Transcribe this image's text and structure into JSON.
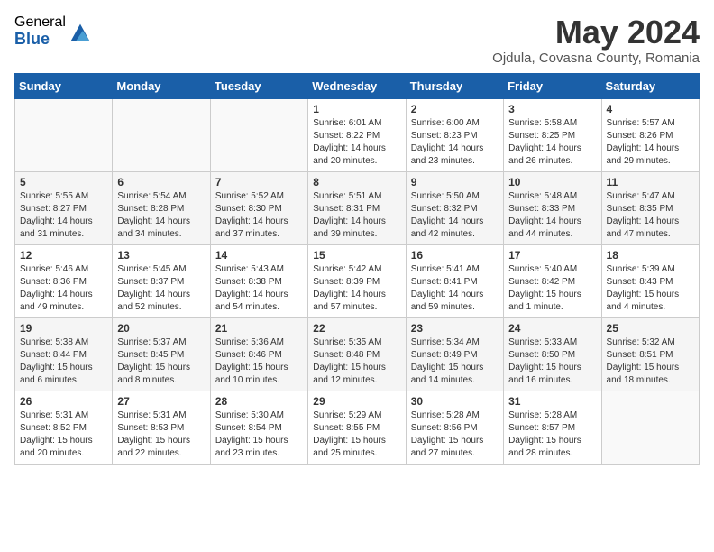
{
  "header": {
    "logo_general": "General",
    "logo_blue": "Blue",
    "month_title": "May 2024",
    "location": "Ojdula, Covasna County, Romania"
  },
  "days_of_week": [
    "Sunday",
    "Monday",
    "Tuesday",
    "Wednesday",
    "Thursday",
    "Friday",
    "Saturday"
  ],
  "weeks": [
    [
      {
        "day": "",
        "content": ""
      },
      {
        "day": "",
        "content": ""
      },
      {
        "day": "",
        "content": ""
      },
      {
        "day": "1",
        "content": "Sunrise: 6:01 AM\nSunset: 8:22 PM\nDaylight: 14 hours\nand 20 minutes."
      },
      {
        "day": "2",
        "content": "Sunrise: 6:00 AM\nSunset: 8:23 PM\nDaylight: 14 hours\nand 23 minutes."
      },
      {
        "day": "3",
        "content": "Sunrise: 5:58 AM\nSunset: 8:25 PM\nDaylight: 14 hours\nand 26 minutes."
      },
      {
        "day": "4",
        "content": "Sunrise: 5:57 AM\nSunset: 8:26 PM\nDaylight: 14 hours\nand 29 minutes."
      }
    ],
    [
      {
        "day": "5",
        "content": "Sunrise: 5:55 AM\nSunset: 8:27 PM\nDaylight: 14 hours\nand 31 minutes."
      },
      {
        "day": "6",
        "content": "Sunrise: 5:54 AM\nSunset: 8:28 PM\nDaylight: 14 hours\nand 34 minutes."
      },
      {
        "day": "7",
        "content": "Sunrise: 5:52 AM\nSunset: 8:30 PM\nDaylight: 14 hours\nand 37 minutes."
      },
      {
        "day": "8",
        "content": "Sunrise: 5:51 AM\nSunset: 8:31 PM\nDaylight: 14 hours\nand 39 minutes."
      },
      {
        "day": "9",
        "content": "Sunrise: 5:50 AM\nSunset: 8:32 PM\nDaylight: 14 hours\nand 42 minutes."
      },
      {
        "day": "10",
        "content": "Sunrise: 5:48 AM\nSunset: 8:33 PM\nDaylight: 14 hours\nand 44 minutes."
      },
      {
        "day": "11",
        "content": "Sunrise: 5:47 AM\nSunset: 8:35 PM\nDaylight: 14 hours\nand 47 minutes."
      }
    ],
    [
      {
        "day": "12",
        "content": "Sunrise: 5:46 AM\nSunset: 8:36 PM\nDaylight: 14 hours\nand 49 minutes."
      },
      {
        "day": "13",
        "content": "Sunrise: 5:45 AM\nSunset: 8:37 PM\nDaylight: 14 hours\nand 52 minutes."
      },
      {
        "day": "14",
        "content": "Sunrise: 5:43 AM\nSunset: 8:38 PM\nDaylight: 14 hours\nand 54 minutes."
      },
      {
        "day": "15",
        "content": "Sunrise: 5:42 AM\nSunset: 8:39 PM\nDaylight: 14 hours\nand 57 minutes."
      },
      {
        "day": "16",
        "content": "Sunrise: 5:41 AM\nSunset: 8:41 PM\nDaylight: 14 hours\nand 59 minutes."
      },
      {
        "day": "17",
        "content": "Sunrise: 5:40 AM\nSunset: 8:42 PM\nDaylight: 15 hours\nand 1 minute."
      },
      {
        "day": "18",
        "content": "Sunrise: 5:39 AM\nSunset: 8:43 PM\nDaylight: 15 hours\nand 4 minutes."
      }
    ],
    [
      {
        "day": "19",
        "content": "Sunrise: 5:38 AM\nSunset: 8:44 PM\nDaylight: 15 hours\nand 6 minutes."
      },
      {
        "day": "20",
        "content": "Sunrise: 5:37 AM\nSunset: 8:45 PM\nDaylight: 15 hours\nand 8 minutes."
      },
      {
        "day": "21",
        "content": "Sunrise: 5:36 AM\nSunset: 8:46 PM\nDaylight: 15 hours\nand 10 minutes."
      },
      {
        "day": "22",
        "content": "Sunrise: 5:35 AM\nSunset: 8:48 PM\nDaylight: 15 hours\nand 12 minutes."
      },
      {
        "day": "23",
        "content": "Sunrise: 5:34 AM\nSunset: 8:49 PM\nDaylight: 15 hours\nand 14 minutes."
      },
      {
        "day": "24",
        "content": "Sunrise: 5:33 AM\nSunset: 8:50 PM\nDaylight: 15 hours\nand 16 minutes."
      },
      {
        "day": "25",
        "content": "Sunrise: 5:32 AM\nSunset: 8:51 PM\nDaylight: 15 hours\nand 18 minutes."
      }
    ],
    [
      {
        "day": "26",
        "content": "Sunrise: 5:31 AM\nSunset: 8:52 PM\nDaylight: 15 hours\nand 20 minutes."
      },
      {
        "day": "27",
        "content": "Sunrise: 5:31 AM\nSunset: 8:53 PM\nDaylight: 15 hours\nand 22 minutes."
      },
      {
        "day": "28",
        "content": "Sunrise: 5:30 AM\nSunset: 8:54 PM\nDaylight: 15 hours\nand 23 minutes."
      },
      {
        "day": "29",
        "content": "Sunrise: 5:29 AM\nSunset: 8:55 PM\nDaylight: 15 hours\nand 25 minutes."
      },
      {
        "day": "30",
        "content": "Sunrise: 5:28 AM\nSunset: 8:56 PM\nDaylight: 15 hours\nand 27 minutes."
      },
      {
        "day": "31",
        "content": "Sunrise: 5:28 AM\nSunset: 8:57 PM\nDaylight: 15 hours\nand 28 minutes."
      },
      {
        "day": "",
        "content": ""
      }
    ]
  ]
}
